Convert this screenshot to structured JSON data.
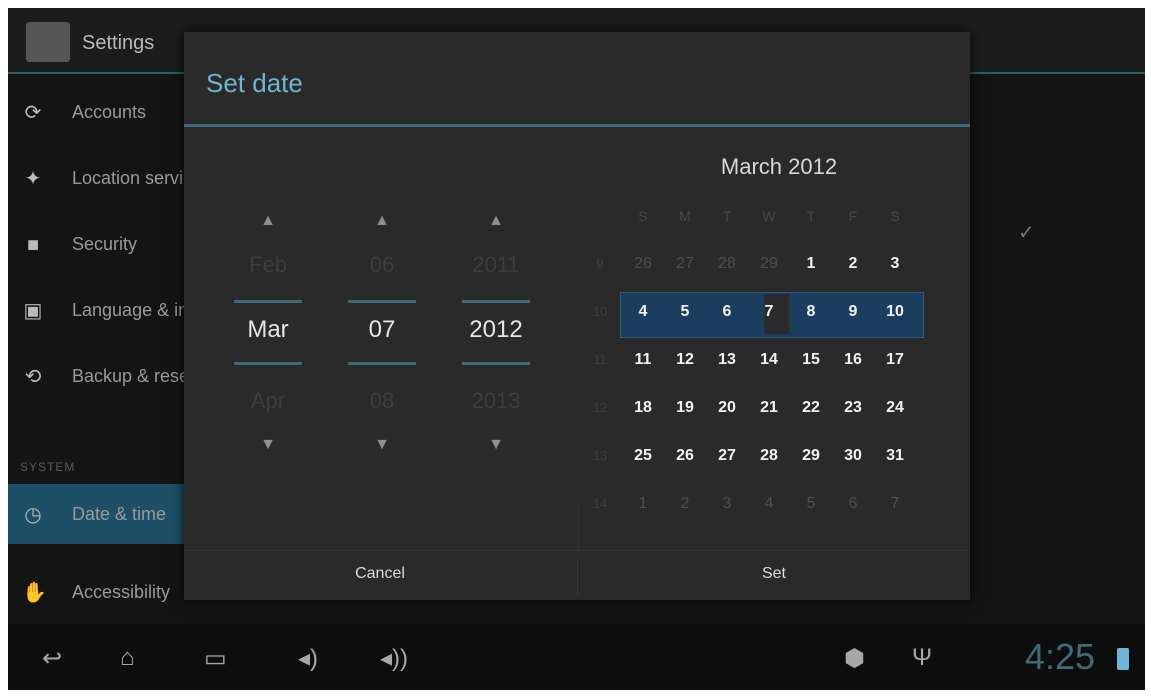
{
  "app": {
    "title": "Settings"
  },
  "sidebar": {
    "items": [
      {
        "label": "Accounts",
        "icon": "sync-icon"
      },
      {
        "label": "Location services",
        "icon": "location-icon"
      },
      {
        "label": "Security",
        "icon": "lock-icon"
      },
      {
        "label": "Language & input",
        "icon": "language-icon"
      },
      {
        "label": "Backup & reset",
        "icon": "backup-icon"
      }
    ],
    "section_label": "SYSTEM",
    "active_item": {
      "label": "Date & time",
      "icon": "clock-icon"
    },
    "last_item": {
      "label": "Accessibility",
      "icon": "accessibility-icon"
    }
  },
  "dialog": {
    "title": "Set date",
    "pickers": [
      {
        "name": "month",
        "prev": "Feb",
        "value": "Mar",
        "next": "Apr"
      },
      {
        "name": "day",
        "prev": "06",
        "value": "07",
        "next": "08"
      },
      {
        "name": "year",
        "prev": "2011",
        "value": "2012",
        "next": "2013"
      }
    ],
    "calendar": {
      "title": "March 2012",
      "weekdays": [
        "S",
        "M",
        "T",
        "W",
        "T",
        "F",
        "S"
      ],
      "week_numbers": [
        "9",
        "10",
        "11",
        "12",
        "13",
        "14"
      ],
      "rows": [
        [
          "26",
          "27",
          "28",
          "29",
          "1",
          "2",
          "3"
        ],
        [
          "4",
          "5",
          "6",
          "7",
          "8",
          "9",
          "10"
        ],
        [
          "11",
          "12",
          "13",
          "14",
          "15",
          "16",
          "17"
        ],
        [
          "18",
          "19",
          "20",
          "21",
          "22",
          "23",
          "24"
        ],
        [
          "25",
          "26",
          "27",
          "28",
          "29",
          "30",
          "31"
        ],
        [
          "1",
          "2",
          "3",
          "4",
          "5",
          "6",
          "7"
        ]
      ],
      "selected": "7"
    },
    "cancel_label": "Cancel",
    "set_label": "Set"
  },
  "status": {
    "time": "4:25"
  },
  "nav": {
    "back_icon": "back-icon",
    "home_icon": "home-icon",
    "recents_icon": "recents-icon",
    "vol_down_icon": "volume-down-icon",
    "vol_up_icon": "volume-up-icon"
  }
}
